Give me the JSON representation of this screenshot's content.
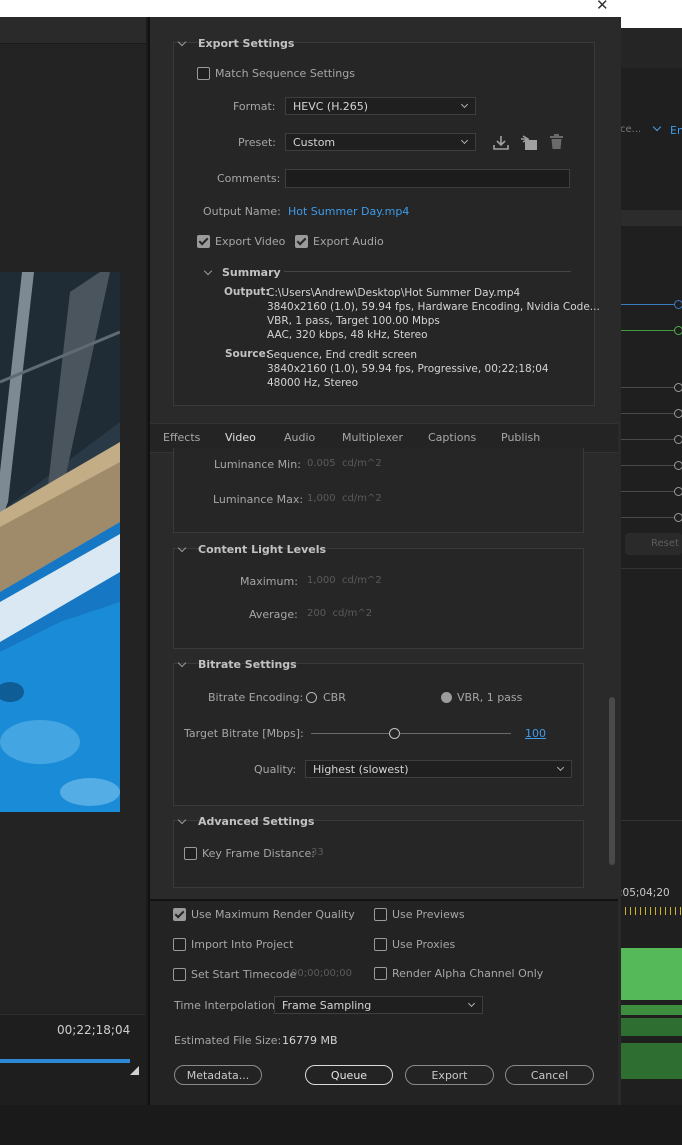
{
  "window": {
    "close_glyph": "✕"
  },
  "program_monitor": {
    "timecode": "00;22;18;04"
  },
  "export_settings": {
    "header": "Export Settings",
    "match_sequence_label": "Match Sequence Settings",
    "match_sequence_checked": false,
    "format_label": "Format:",
    "format_value": "HEVC (H.265)",
    "preset_label": "Preset:",
    "preset_value": "Custom",
    "comments_label": "Comments:",
    "comments_value": "",
    "output_name_label": "Output Name:",
    "output_name_value": "Hot Summer Day.mp4",
    "export_video_label": "Export Video",
    "export_video_checked": true,
    "export_audio_label": "Export Audio",
    "export_audio_checked": true,
    "summary": {
      "header": "Summary",
      "output_label": "Output:",
      "output_lines": [
        "C:\\Users\\Andrew\\Desktop\\Hot Summer Day.mp4",
        "3840x2160 (1.0), 59.94 fps, Hardware Encoding, Nvidia Code...",
        "VBR, 1 pass, Target 100.00 Mbps",
        "AAC, 320 kbps, 48 kHz, Stereo"
      ],
      "source_label": "Source:",
      "source_lines": [
        "Sequence, End credit screen",
        "3840x2160 (1.0), 59.94 fps, Progressive, 00;22;18;04",
        "48000 Hz, Stereo"
      ]
    }
  },
  "tabs": [
    "Effects",
    "Video",
    "Audio",
    "Multiplexer",
    "Captions",
    "Publish"
  ],
  "active_tab": "Video",
  "hdr": {
    "lum_min_label": "Luminance Min:",
    "lum_min_value": "0.005",
    "lum_min_unit": "cd/m^2",
    "lum_max_label": "Luminance Max:",
    "lum_max_value": "1,000",
    "lum_max_unit": "cd/m^2"
  },
  "content_light": {
    "header": "Content Light Levels",
    "maximum_label": "Maximum:",
    "maximum_value": "1,000",
    "maximum_unit": "cd/m^2",
    "average_label": "Average:",
    "average_value": "200",
    "average_unit": "cd/m^2"
  },
  "bitrate": {
    "header": "Bitrate Settings",
    "encoding_label": "Bitrate Encoding:",
    "cbr_label": "CBR",
    "vbr_label": "VBR, 1 pass",
    "selected": "VBR, 1 pass",
    "target_label": "Target Bitrate [Mbps]:",
    "target_value": "100",
    "quality_label": "Quality:",
    "quality_value": "Highest (slowest)"
  },
  "advanced": {
    "header": "Advanced Settings",
    "keyframe_label": "Key Frame Distance:",
    "keyframe_value": "33",
    "keyframe_checked": false
  },
  "render_options": {
    "max_render_quality": "Use Maximum Render Quality",
    "max_render_quality_checked": true,
    "use_previews": "Use Previews",
    "import_into_project": "Import Into Project",
    "use_proxies": "Use Proxies",
    "set_start_timecode": "Set Start Timecode",
    "start_timecode_value": "00;00;00;00",
    "render_alpha": "Render Alpha Channel Only",
    "time_interp_label": "Time Interpolation:",
    "time_interp_value": "Frame Sampling",
    "file_size_label": "Estimated File Size:",
    "file_size_value": "16779 MB"
  },
  "buttons": {
    "metadata": "Metadata...",
    "queue": "Queue",
    "export": "Export",
    "cancel": "Cancel"
  },
  "right_panel": {
    "partial_label_1": "ce...",
    "partial_label_2": "En",
    "reset_label": "Reset",
    "timecode": ";05;04;20"
  }
}
